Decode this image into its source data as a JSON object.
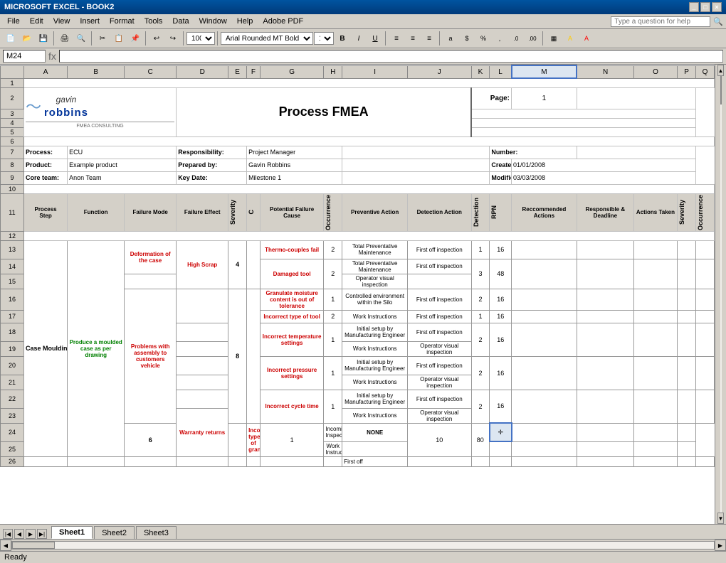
{
  "window": {
    "title": "MICROSOFT EXCEL - BOOK2",
    "controls": [
      "_",
      "□",
      "×"
    ]
  },
  "menubar": {
    "items": [
      "File",
      "Edit",
      "View",
      "Insert",
      "Format",
      "Tools",
      "Data",
      "Window",
      "Help",
      "Adobe PDF"
    ],
    "search_placeholder": "Type a question for help"
  },
  "formula_bar": {
    "cell_ref": "M24",
    "formula": ""
  },
  "toolbar": {
    "zoom": "100%",
    "font": "Arial Rounded MT Bold",
    "font_size": "10"
  },
  "spreadsheet": {
    "title": "Process FMEA",
    "page_label": "Page:",
    "page_number": "1",
    "fields": [
      {
        "label": "Process:",
        "value": "ECU"
      },
      {
        "label": "Responsibility:",
        "value": "Project Manager"
      },
      {
        "label": "Number:",
        "value": ""
      },
      {
        "label": "Product:",
        "value": "Example product"
      },
      {
        "label": "Prepared by:",
        "value": "Gavin Robbins"
      },
      {
        "label": "Created:",
        "value": "01/01/2008"
      },
      {
        "label": "Core team:",
        "value": "Anon Team"
      },
      {
        "label": "Key Date:",
        "value": "Milestone 1"
      },
      {
        "label": "Modified:",
        "value": "03/03/2008"
      }
    ],
    "col_headers": [
      "A",
      "B",
      "C",
      "D",
      "E",
      "F",
      "G",
      "H",
      "I",
      "J",
      "K",
      "L",
      "M",
      "N",
      "O",
      "P",
      "Q"
    ],
    "table_headers": {
      "process_step": "Process Step",
      "function": "Function",
      "failure_mode": "Failure Mode",
      "failure_effect": "Failure Effect",
      "severity": "Severity",
      "c": "C",
      "potential_failure_cause": "Potential Failure Cause",
      "occurrence": "Occurrence",
      "preventive_action": "Preventive Action",
      "detection_action": "Detection Action",
      "detection": "Detection",
      "rpn": "RPN",
      "recommended_actions": "Reccommended Actions",
      "responsible_deadline": "Responsible & Deadline",
      "actions_taken": "Actions Taken",
      "severity2": "Severity",
      "occurrence2": "Occurrence"
    },
    "rows": [
      {
        "row_num": "13",
        "process_step": "Case Moulding",
        "function": "Produce a moulded case as per drawing",
        "function_color": "green",
        "failure_mode": "Deformation of the case",
        "failure_mode_color": "red",
        "failure_effect": "High Scrap",
        "failure_effect_color": "red",
        "severity": "4",
        "c": "",
        "potential_failure_cause": "Thermo-couples fail",
        "pfc_color": "red",
        "occurrence": "2",
        "preventive_action": "Total Preventative Maintenance",
        "detection_action": "First off inspection",
        "detection": "1",
        "rpn": "16",
        "recommended_actions": "",
        "responsible_deadline": "",
        "actions_taken": "",
        "severity2": "",
        "occurrence2": ""
      },
      {
        "row_num": "14",
        "potential_failure_cause": "Damaged tool",
        "pfc_color": "red",
        "occurrence": "2",
        "preventive_action": "Total Preventative Maintenance",
        "detection_action": "First off inspection",
        "detection": "3",
        "rpn": "48"
      },
      {
        "row_num": "15",
        "detection_action": "Operator visual inspection"
      },
      {
        "row_num": "16",
        "failure_mode": "Problems with assembly to customers vehicle",
        "failure_mode_color": "red",
        "severity": "8",
        "potential_failure_cause": "Granulate moisture content is out of tolerance",
        "pfc_color": "red",
        "occurrence": "1",
        "preventive_action": "Controlled environment within the Silo",
        "detection_action": "First off inspection",
        "detection": "2",
        "rpn": "16"
      },
      {
        "row_num": "17",
        "potential_failure_cause": "Incorrect type of tool",
        "pfc_color": "red",
        "occurrence": "2",
        "preventive_action": "Work Instructions",
        "detection_action": "First off inspection",
        "detection": "1",
        "rpn": "16"
      },
      {
        "row_num": "18",
        "potential_failure_cause": "Incorrect temperature settings",
        "pfc_color": "red",
        "occurrence": "1",
        "preventive_action": "Initial setup by Manufacturing Engineer",
        "detection_action": "First off inspection",
        "detection": "2",
        "rpn": "16"
      },
      {
        "row_num": "19",
        "preventive_action": "Work Instructions",
        "detection_action": "Operator visual inspection"
      },
      {
        "row_num": "20",
        "potential_failure_cause": "Incorrect pressure settings",
        "pfc_color": "red",
        "occurrence": "1",
        "preventive_action": "Initial setup by Manufacturing Engineer",
        "detection_action": "First off inspection",
        "detection": "2",
        "rpn": "16"
      },
      {
        "row_num": "21",
        "preventive_action": "Work Instructions",
        "detection_action": "Operator visual inspection"
      },
      {
        "row_num": "22",
        "potential_failure_cause": "Incorrect cycle time",
        "pfc_color": "red",
        "occurrence": "1",
        "preventive_action": "Initial setup by Manufacturing Engineer",
        "detection_action": "First off inspection",
        "detection": "2",
        "rpn": "16"
      },
      {
        "row_num": "23",
        "failure_mode": "Warranty returns",
        "failure_mode_color": "red",
        "severity": "6",
        "preventive_action": "Work Instructions",
        "detection_action": "Operator visual inspection"
      },
      {
        "row_num": "24",
        "potential_failure_cause": "Incorrect type of granulate",
        "pfc_color": "red",
        "occurrence": "1",
        "preventive_action": "Incoming Inspection",
        "detection_action": "NONE",
        "detection": "10",
        "rpn": "80",
        "cursor": true
      },
      {
        "row_num": "25",
        "preventive_action": "Work Instructions"
      }
    ]
  },
  "sheet_tabs": [
    "Sheet1",
    "Sheet2",
    "Sheet3"
  ],
  "active_tab": "Sheet1",
  "status_bar": "Ready"
}
